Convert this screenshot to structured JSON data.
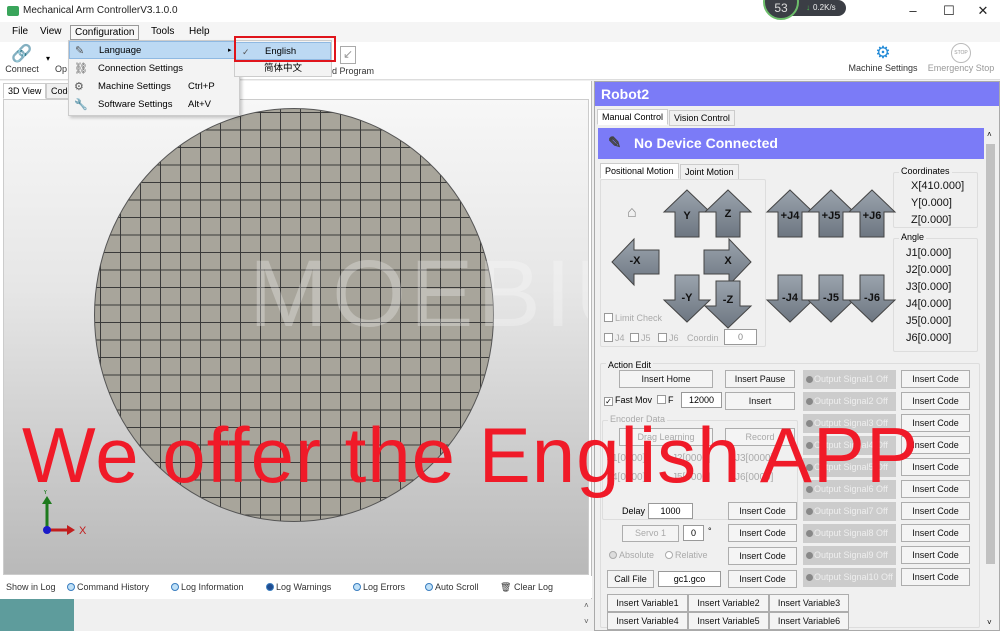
{
  "window": {
    "title": "Mechanical Arm ControllerV3.1.0.0",
    "controls": {
      "minimize": "–",
      "maximize": "☐",
      "close": "✕"
    },
    "net_monitor": {
      "percent": "53",
      "speed": "0.2K/s"
    }
  },
  "menubar": {
    "items": [
      "File",
      "View",
      "Configuration",
      "Tools",
      "Help"
    ],
    "active": "Configuration"
  },
  "config_menu": {
    "items": [
      {
        "label": "Language",
        "shortcut": "",
        "icon": "pencil-icon",
        "submenu": true
      },
      {
        "label": "Connection Settings",
        "shortcut": "",
        "icon": "link-icon"
      },
      {
        "label": "Machine Settings",
        "shortcut": "Ctrl+P",
        "icon": "gears-icon"
      },
      {
        "label": "Software Settings",
        "shortcut": "Alt+V",
        "icon": "wrench-icon"
      }
    ],
    "language_submenu": [
      {
        "label": "English",
        "checked": true
      },
      {
        "label": "简体中文",
        "checked": false
      }
    ]
  },
  "toolbar": {
    "connect": "Connect",
    "open_partial": "Op",
    "load_program_partial": "d Program",
    "machine_settings": "Machine Settings",
    "emergency_stop": "Emergency Stop",
    "stop_glyph": "STOP"
  },
  "left_panel": {
    "tabs": [
      "3D View",
      "Code"
    ],
    "watermark": "MOEBIUS",
    "axis_labels": {
      "x": "X",
      "y": "Y"
    }
  },
  "log": {
    "label": "Show in Log",
    "options": [
      {
        "label": "Command History",
        "selected": false
      },
      {
        "label": "Log Information",
        "selected": false
      },
      {
        "label": "Log Warnings",
        "selected": true
      },
      {
        "label": "Log Errors",
        "selected": false
      },
      {
        "label": "Auto Scroll",
        "selected": false
      }
    ],
    "clear": "Clear Log"
  },
  "robot": {
    "name": "Robot2",
    "tabs": [
      "Manual Control",
      "Vision Control"
    ],
    "status": "No Device Connected",
    "motion_tabs": [
      "Positional Motion",
      "Joint Motion"
    ],
    "jog": {
      "up": [
        "Y",
        "Z",
        "+J4",
        "+J5",
        "+J6"
      ],
      "left": "-X",
      "right": "X",
      "down": [
        "-Y",
        "-Z",
        "-J4",
        "-J5",
        "-J6"
      ]
    },
    "limit_check": "Limit Check",
    "joint_checks": [
      "J4",
      "J5",
      "J6"
    ],
    "coordin_label": "Coordin",
    "coordin_value": "0",
    "coordinates": {
      "title": "Coordinates",
      "values": [
        "X[410.000]",
        "Y[0.000]",
        "Z[0.000]"
      ]
    },
    "angle": {
      "title": "Angle",
      "values": [
        "J1[0.000]",
        "J2[0.000]",
        "J3[0.000]",
        "J4[0.000]",
        "J5[0.000]",
        "J6[0.000]"
      ]
    }
  },
  "action_edit": {
    "title": "Action Edit",
    "insert_home": "Insert Home",
    "insert_pause": "Insert Pause",
    "fast_move": "Fast Mov",
    "fast_move_checked": true,
    "f_label": "F",
    "f_checked": false,
    "f_value": "12000",
    "insert": "Insert",
    "encoder_title": "Encoder Data",
    "drag_learning": "Drag Learning",
    "record": "Record",
    "encoder_values": [
      "J1[0000]",
      "J2[0000]",
      "J3[0000]",
      "J4[0000]",
      "J5[0000]",
      "J6[0000]"
    ],
    "delay_label": "Delay",
    "delay_value": "1000",
    "servo_label": "Servo 1",
    "servo_value": "0",
    "degree": "°",
    "absolute": "Absolute",
    "relative": "Relative",
    "call_file": "Call File",
    "file_value": "gc1.gco",
    "insert_code": "Insert Code",
    "signals": [
      "Output Signal1 Off",
      "Output Signal2 Off",
      "Output Signal3 Off",
      "Output Signal4 Off",
      "Output Signal5 Off",
      "Output Signal6 Off",
      "Output Signal7 Off",
      "Output Signal8 Off",
      "Output Signal9 Off",
      "Output Signal10 Off"
    ],
    "variables": [
      "Insert Variable1",
      "Insert Variable2",
      "Insert Variable3",
      "Insert Variable4",
      "Insert Variable5",
      "Insert Variable6"
    ]
  },
  "overlay_text": "We offer the English APP"
}
